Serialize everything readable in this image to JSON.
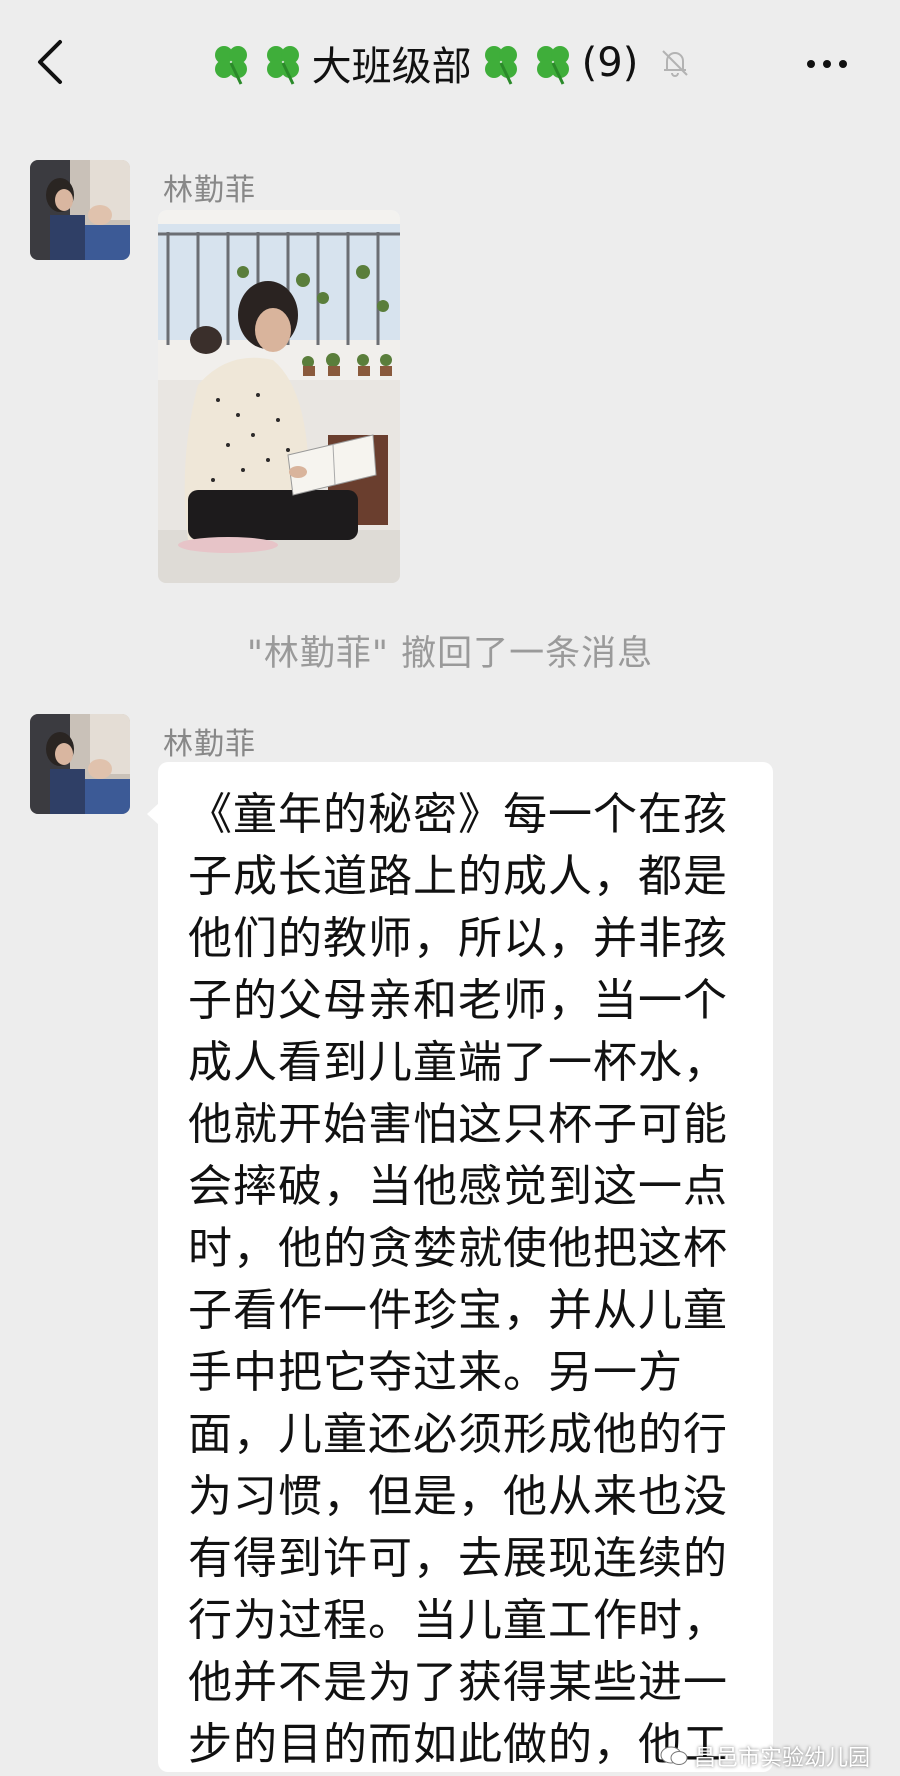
{
  "header": {
    "title": "大班级部",
    "count": "(9)",
    "back_icon": "chevron-left-icon",
    "mute_icon": "bell-off-icon",
    "more_icon": "more-dots-icon"
  },
  "messages": [
    {
      "sender": "林勤菲",
      "type": "image"
    },
    {
      "system": "\"林勤菲\" 撤回了一条消息"
    },
    {
      "sender": "林勤菲",
      "type": "text",
      "text": "《童年的秘密》每一个在孩子成长道路上的成人，都是他们的教师，所以，并非孩子的父母亲和老师，当一个成人看到儿童端了一杯水，他就开始害怕这只杯子可能会摔破，当他感觉到这一点时，他的贪婪就使他把这杯子看作一件珍宝，并从儿童手中把它夺过来。另一方面，儿童还必须形成他的行为习惯，但是，他从来也没有得到许可，去展现连续的行为过程。当儿童工作时，他并不是为了获得某些进一步的目的而如此做的，他工"
    }
  ],
  "watermark": "昌邑市实验幼儿园",
  "colors": {
    "background": "#ededed",
    "bubble": "#ffffff",
    "clover": "#3fae3a"
  }
}
